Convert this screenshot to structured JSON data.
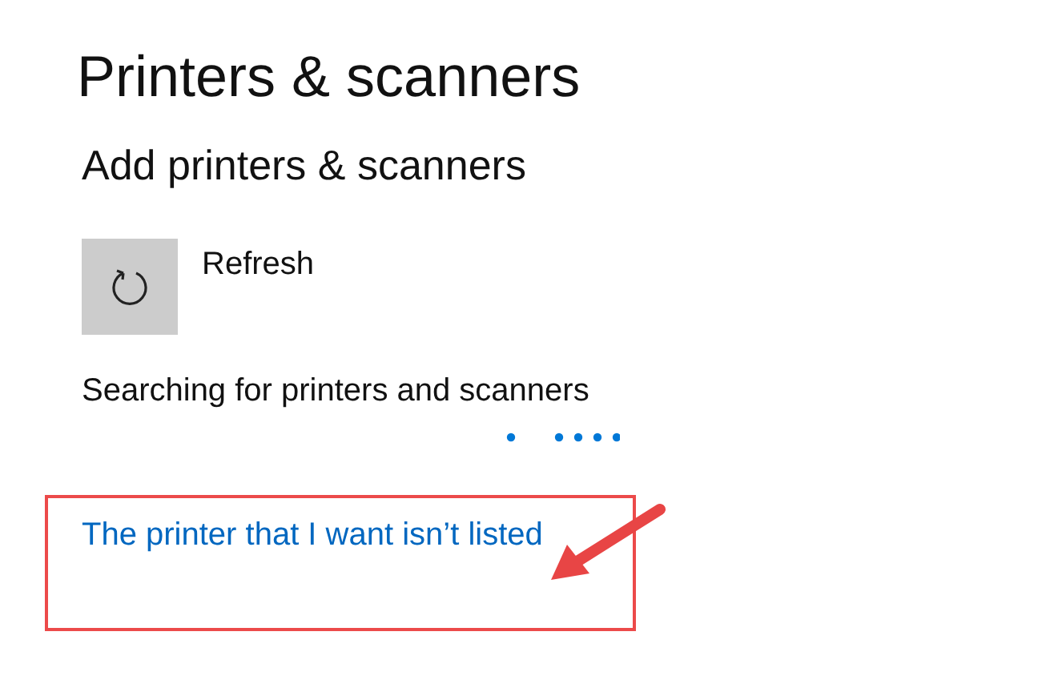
{
  "page": {
    "title": "Printers & scanners"
  },
  "section": {
    "heading": "Add printers & scanners"
  },
  "refresh": {
    "label": "Refresh"
  },
  "status": {
    "text": "Searching for printers and scanners"
  },
  "link": {
    "text": "The printer that I want isn’t listed"
  }
}
